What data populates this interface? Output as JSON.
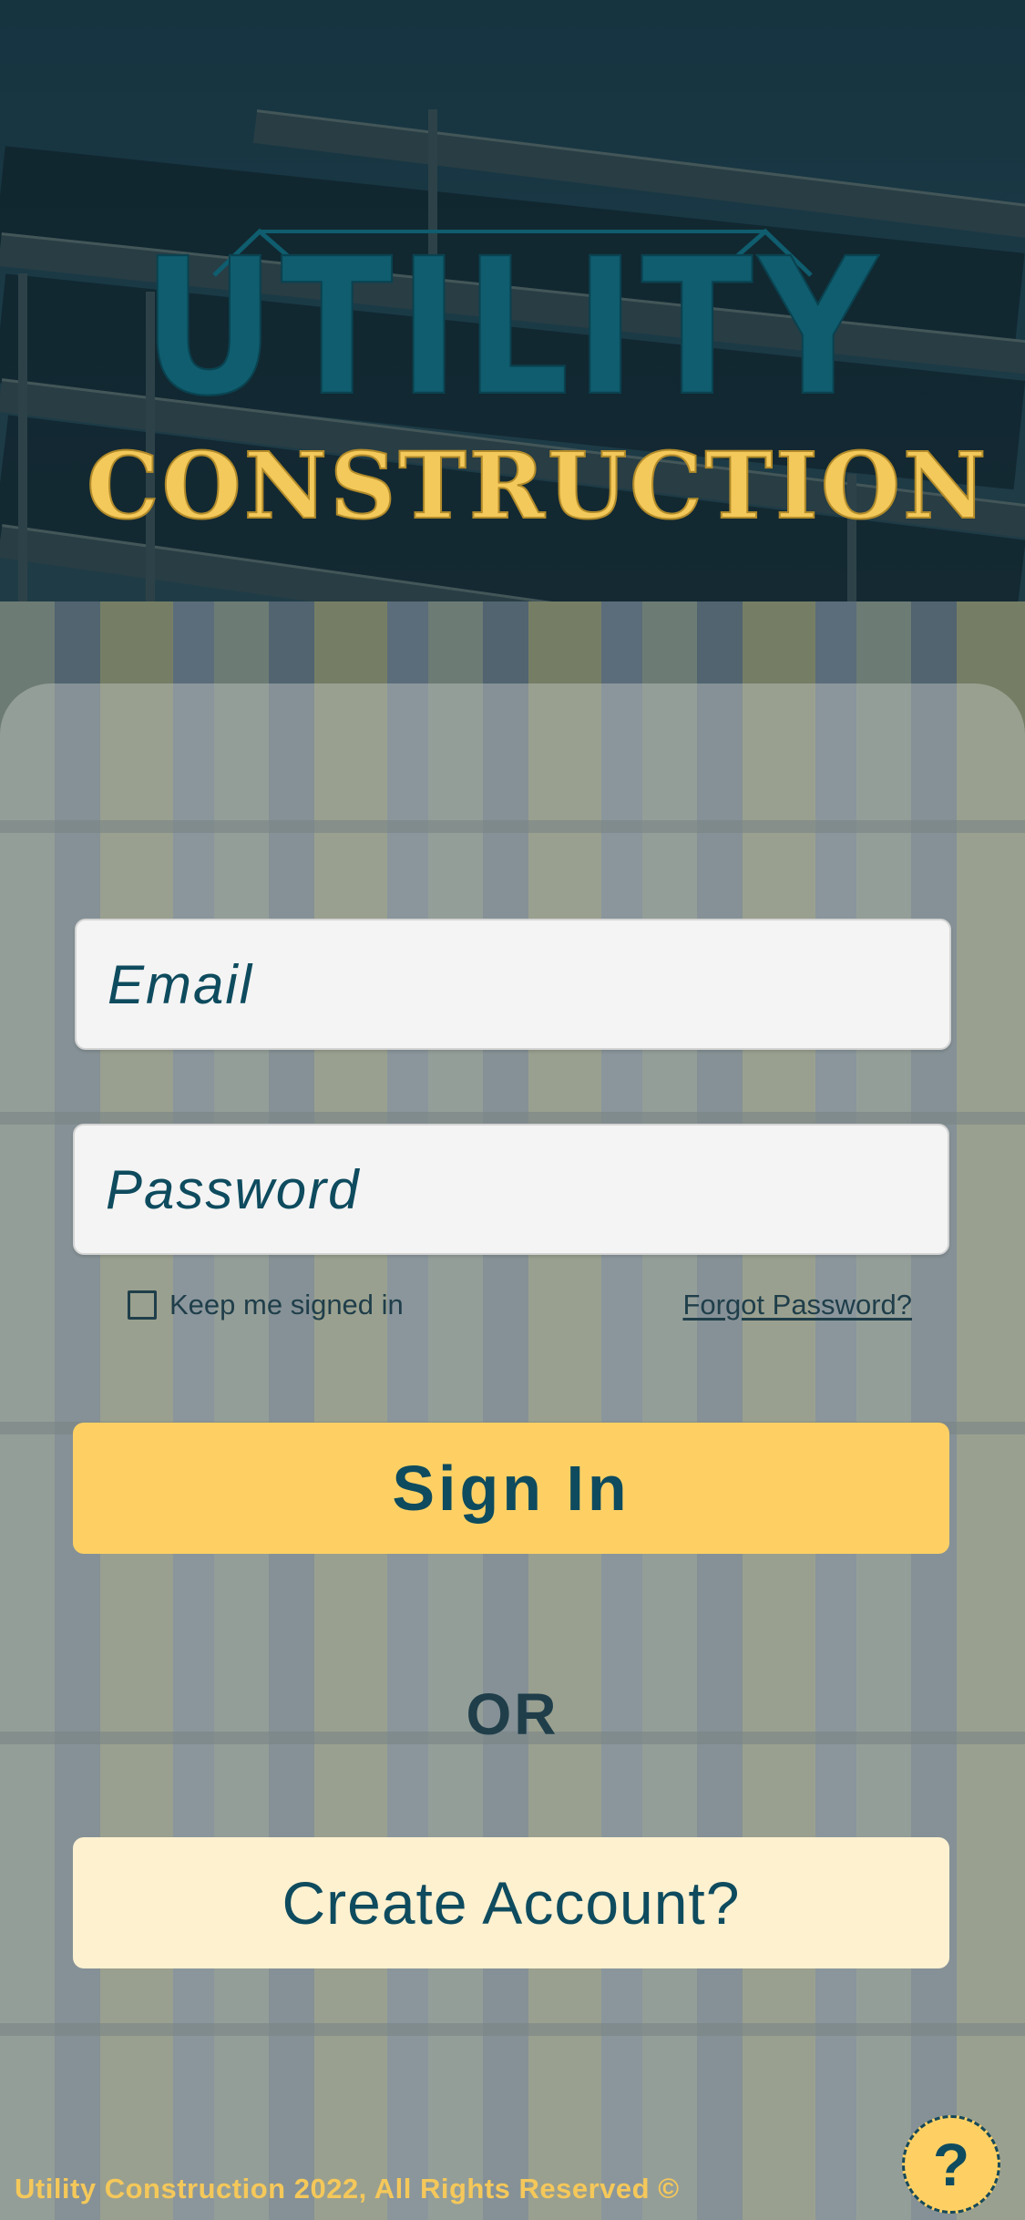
{
  "brand": {
    "logo_top": "UTILITY",
    "logo_bottom": "CONSTRUCTION",
    "colors": {
      "teal": "#0f5d6e",
      "gold": "#f4c95b"
    }
  },
  "login": {
    "email": {
      "placeholder": "Email",
      "value": ""
    },
    "password": {
      "placeholder": "Password",
      "value": ""
    },
    "keep_signed_in": {
      "label": "Keep me signed in",
      "checked": false
    },
    "forgot_password": "Forgot Password?",
    "sign_in_label": "Sign In",
    "or_label": "OR",
    "create_account_label": "Create Account?"
  },
  "footer": {
    "text": "Utility Construction 2022, All Rights Reserved ©"
  },
  "help": {
    "label": "?",
    "icon": "question-mark-icon"
  },
  "theme": {
    "primary_button": "#fed064",
    "secondary_button": "#fef1d0",
    "text_dark": "#0e4b5e"
  }
}
